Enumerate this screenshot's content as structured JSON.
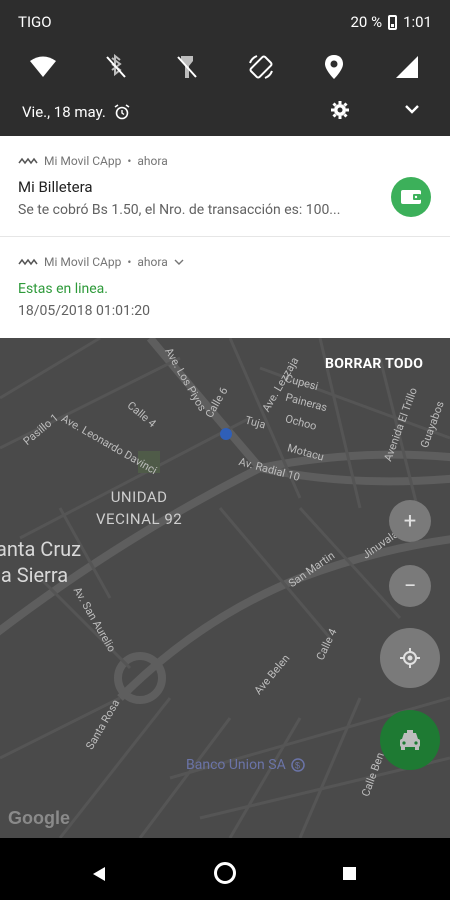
{
  "status_bar": {
    "carrier": "TIGO",
    "battery": "20 %",
    "time": "1:01"
  },
  "quick_settings": {
    "tiles": [
      "wifi-icon",
      "bluetooth-off-icon",
      "flashlight-off-icon",
      "auto-rotate-icon",
      "location-icon",
      "cellular-icon"
    ],
    "date": "Vie., 18 may.",
    "alarm_icon": "alarm-icon",
    "settings_icon": "gear-icon",
    "expand_icon": "chevron-down-icon"
  },
  "notifications": [
    {
      "app": "Mi Movil CApp",
      "when": "ahora",
      "title": "Mi Billetera",
      "body": "Se te cobró Bs 1.50, el Nro. de transacción es: 100..."
    },
    {
      "app": "Mi Movil CApp",
      "when": "ahora",
      "status": "Estas en linea.",
      "datetime": "18/05/2018 01:01:20"
    }
  ],
  "map": {
    "clear_all": "BORRAR TODO",
    "city_line1": "anta Cruz",
    "city_line2": "la Sierra",
    "district_line1": "UNIDAD",
    "district_line2": "VECINAL 92",
    "bank": "Banco Union SA",
    "google": "Google",
    "streets": {
      "s1": "Ave. Los Piyos",
      "s2": "Calle 6",
      "s3": "Ave. Leonardo Davinci",
      "s4": "Calle 4",
      "s5": "Pasillo 1",
      "s6": "Ave. Lezzaja",
      "s7": "Cupesi",
      "s8": "Paineras",
      "s9": "Ochoo",
      "s10": "Tuja",
      "s11": "Motacu",
      "s12": "Av. Radial 10",
      "s13": "Avenida El Trillo",
      "s14": "Guayabos",
      "s15": "Jinuvala",
      "s16": "San Martin",
      "s17": "Av. San Aurelio",
      "s18": "Ave Belen",
      "s19": "Calle 4",
      "s20": "Santa Rosa",
      "s21": "Calle Ben"
    }
  },
  "controls": {
    "zoom_in": "+",
    "zoom_out": "−"
  }
}
